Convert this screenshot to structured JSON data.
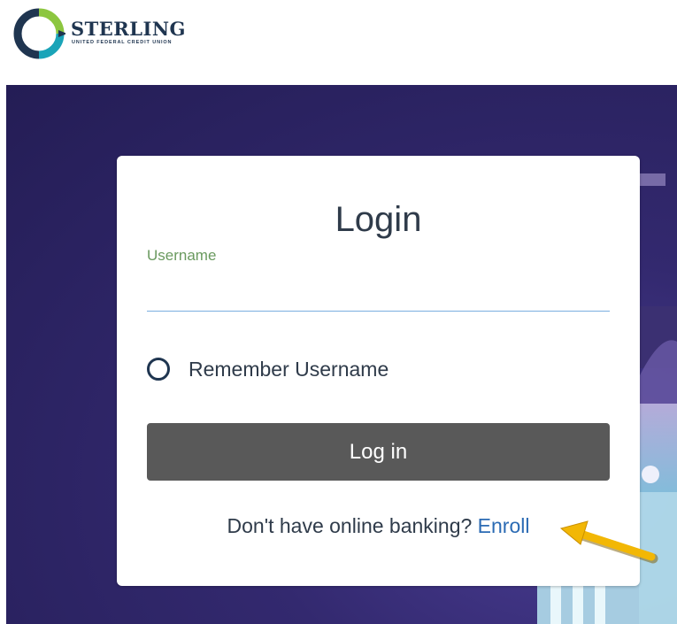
{
  "brand": {
    "name": "STERLING",
    "subtitle": "UNITED FEDERAL CREDIT UNION"
  },
  "login": {
    "title": "Login",
    "username_label": "Username",
    "username_value": "",
    "remember_label": "Remember Username",
    "remember_checked": false,
    "submit_label": "Log in",
    "enroll_prompt": "Don't have online banking?",
    "enroll_link": "Enroll"
  },
  "colors": {
    "brand_navy": "#1f3550",
    "brand_green": "#8cc63f",
    "brand_teal": "#1aa4b8",
    "hero_purple": "#2f2766",
    "button_gray": "#595959",
    "link_blue": "#2b6bb4",
    "label_green": "#6a9a5f",
    "annotation_arrow": "#f2b705"
  }
}
